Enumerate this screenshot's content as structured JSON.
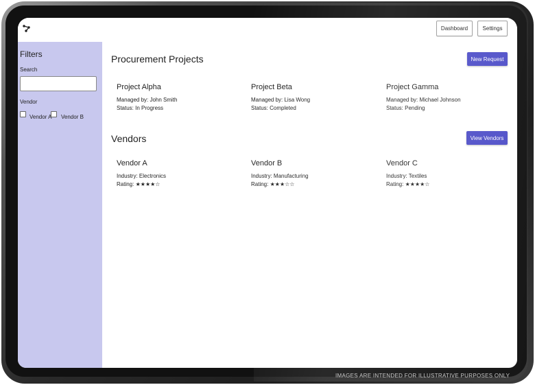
{
  "topbar": {
    "dashboard_label": "Dashboard",
    "settings_label": "Settings"
  },
  "sidebar": {
    "title": "Filters",
    "search_label": "Search",
    "search_value": "",
    "vendor_label": "Vendor",
    "vendor_options": [
      "Vendor A",
      "Vendor B"
    ]
  },
  "projects": {
    "title": "Procurement Projects",
    "action_label": "New Request",
    "items": [
      {
        "name": "Project Alpha",
        "manager": "Managed by: John Smith",
        "status": "Status: In Progress"
      },
      {
        "name": "Project Beta",
        "manager": "Managed by: Lisa Wong",
        "status": "Status: Completed"
      },
      {
        "name": "Project Gamma",
        "manager": "Managed by: Michael Johnson",
        "status": "Status: Pending"
      }
    ]
  },
  "vendors": {
    "title": "Vendors",
    "action_label": "View Vendors",
    "items": [
      {
        "name": "Vendor A",
        "industry": "Industry: Electronics",
        "rating_label": "Rating:",
        "rating": 4,
        "rating_stars": "★★★★☆"
      },
      {
        "name": "Vendor B",
        "industry": "Industry: Manufacturing",
        "rating_label": "Rating:",
        "rating": 3,
        "rating_stars": "★★★☆☆"
      },
      {
        "name": "Vendor C",
        "industry": "Industry: Textiles",
        "rating_label": "Rating:",
        "rating": 4,
        "rating_stars": "★★★★☆"
      }
    ]
  },
  "watermark": "IMAGES ARE INTENDED FOR ILLUSTRATIVE PURPOSES ONLY",
  "colors": {
    "accent": "#4f4fc8",
    "sidebar_bg": "#c8c8ee"
  },
  "icons": {
    "logo": "network-nodes-icon"
  }
}
